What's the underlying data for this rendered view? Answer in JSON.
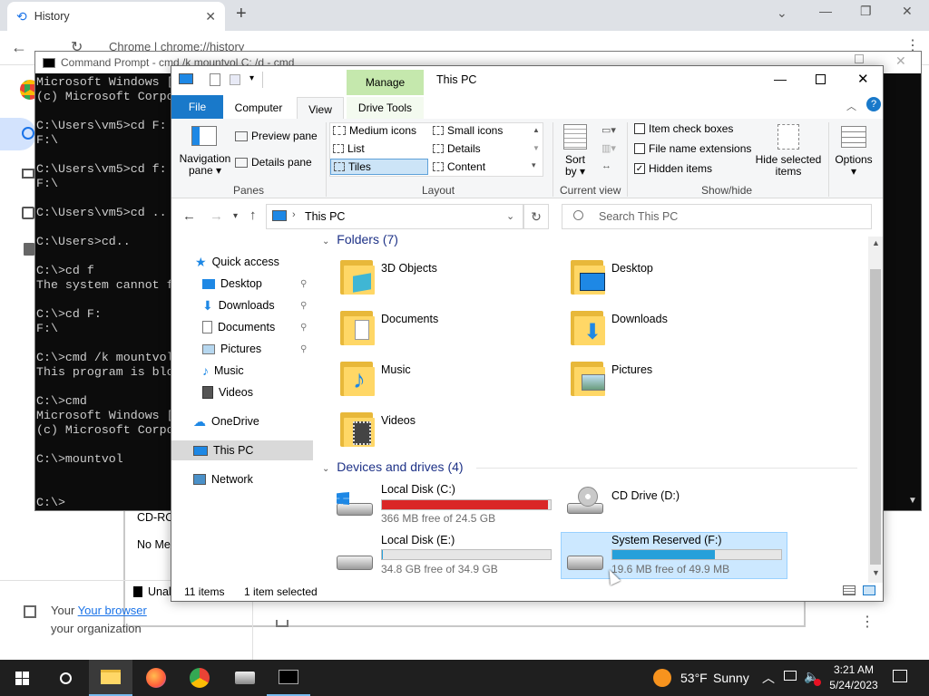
{
  "chrome": {
    "tab_title": "History",
    "new_tab": "+",
    "address": "Chrome | chrome://history",
    "left_notice_browser": "Your browser",
    "left_notice_org": "your organization",
    "page_snippets": [
      "CD-RO",
      "No Me",
      "Unal"
    ]
  },
  "cmd": {
    "title": "Command Prompt - cmd  /k mountvol C: /d - cmd",
    "lines": [
      "Microsoft Windows [",
      "(c) Microsoft Corpo",
      "",
      "C:\\Users\\vm5>cd F:",
      "F:\\",
      "",
      "C:\\Users\\vm5>cd f:",
      "F:\\",
      "",
      "C:\\Users\\vm5>cd ..",
      "",
      "C:\\Users>cd..",
      "",
      "C:\\>cd f",
      "The system cannot f",
      "",
      "C:\\>cd F:",
      "F:\\",
      "",
      "C:\\>cmd /k mountvol",
      "This program is blo",
      "",
      "C:\\>cmd",
      "Microsoft Windows [",
      "(c) Microsoft Corpo",
      "",
      "C:\\>mountvol",
      "",
      "",
      "C:\\>"
    ]
  },
  "explorer": {
    "title": "This PC",
    "manage": "Manage",
    "drive_tools": "Drive Tools",
    "tabs": {
      "file": "File",
      "computer": "Computer",
      "view": "View"
    },
    "ribbon": {
      "navigation_pane": "Navigation pane",
      "navigation_pane_l1": "Navigation",
      "navigation_pane_l2": "pane",
      "preview_pane": "Preview pane",
      "details_pane": "Details pane",
      "panes": "Panes",
      "medium_icons": "Medium icons",
      "small_icons": "Small icons",
      "list": "List",
      "details": "Details",
      "tiles": "Tiles",
      "content": "Content",
      "layout": "Layout",
      "sort_l1": "Sort",
      "sort_l2": "by",
      "current_view": "Current view",
      "item_check_boxes": "Item check boxes",
      "file_name_extensions": "File name extensions",
      "hidden_items": "Hidden items",
      "hide_selected_l1": "Hide selected",
      "hide_selected_l2": "items",
      "options": "Options",
      "show_hide": "Show/hide"
    },
    "address": "This PC",
    "search_placeholder": "Search This PC",
    "nav": {
      "quick_access": "Quick access",
      "desktop": "Desktop",
      "downloads": "Downloads",
      "documents": "Documents",
      "pictures": "Pictures",
      "music": "Music",
      "videos": "Videos",
      "onedrive": "OneDrive",
      "this_pc": "This PC",
      "network": "Network"
    },
    "folders_header": "Folders (7)",
    "folders": [
      "3D Objects",
      "Desktop",
      "Documents",
      "Downloads",
      "Music",
      "Pictures",
      "Videos"
    ],
    "drives_header": "Devices and drives (4)",
    "drives": {
      "c": {
        "name": "Local Disk (C:)",
        "free": "366 MB free of 24.5 GB",
        "used_fraction": 0.985,
        "color": "#da2626"
      },
      "d": {
        "name": "CD Drive (D:)"
      },
      "e": {
        "name": "Local Disk (E:)",
        "free": "34.8 GB free of 34.9 GB",
        "used_fraction": 0.003,
        "color": "#26a0da"
      },
      "f": {
        "name": "System Reserved (F:)",
        "free": "19.6 MB free of 49.9 MB",
        "used_fraction": 0.607,
        "color": "#26a0da"
      }
    },
    "status_items": "11 items",
    "status_selected": "1 item selected"
  },
  "taskbar": {
    "weather_temp": "53°F",
    "weather_desc": "Sunny",
    "time": "3:21 AM",
    "date": "5/24/2023"
  }
}
